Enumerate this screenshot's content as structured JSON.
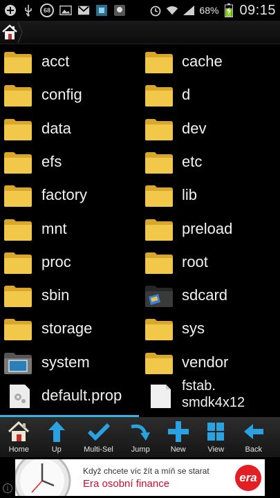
{
  "status_bar": {
    "notification_count": "68",
    "battery_percent": "68%",
    "time": "09:15"
  },
  "files": [
    {
      "name": "acct",
      "type": "folder"
    },
    {
      "name": "cache",
      "type": "folder"
    },
    {
      "name": "config",
      "type": "folder"
    },
    {
      "name": "d",
      "type": "folder"
    },
    {
      "name": "data",
      "type": "folder"
    },
    {
      "name": "dev",
      "type": "folder"
    },
    {
      "name": "efs",
      "type": "folder"
    },
    {
      "name": "etc",
      "type": "folder"
    },
    {
      "name": "factory",
      "type": "folder"
    },
    {
      "name": "lib",
      "type": "folder"
    },
    {
      "name": "mnt",
      "type": "folder"
    },
    {
      "name": "preload",
      "type": "folder"
    },
    {
      "name": "proc",
      "type": "folder"
    },
    {
      "name": "root",
      "type": "folder"
    },
    {
      "name": "sbin",
      "type": "folder"
    },
    {
      "name": "sdcard",
      "type": "sdcard-folder"
    },
    {
      "name": "storage",
      "type": "folder"
    },
    {
      "name": "sys",
      "type": "folder"
    },
    {
      "name": "system",
      "type": "system-folder"
    },
    {
      "name": "vendor",
      "type": "folder"
    },
    {
      "name": "default.prop",
      "type": "settings-file"
    },
    {
      "name": "fstab.\nsmdk4x12",
      "type": "file"
    }
  ],
  "toolbar": [
    {
      "label": "Home",
      "icon": "home-icon"
    },
    {
      "label": "Up",
      "icon": "up-arrow-icon"
    },
    {
      "label": "Multi-Sel",
      "icon": "checkmark-icon"
    },
    {
      "label": "Jump",
      "icon": "jump-arrow-icon"
    },
    {
      "label": "New",
      "icon": "plus-icon"
    },
    {
      "label": "View",
      "icon": "grid-icon"
    },
    {
      "label": "Back",
      "icon": "back-arrow-icon"
    }
  ],
  "ad": {
    "line1": "Když chcete víc žít a míň se starat",
    "line2": "Era osobní finance",
    "logo": "era"
  },
  "colors": {
    "folder_fill": "#f2c84b",
    "folder_dark": "#d9a82b",
    "accent_blue": "#33b5e5",
    "toolbar_blue": "#2aa2e0",
    "ad_red": "#e31e24"
  }
}
